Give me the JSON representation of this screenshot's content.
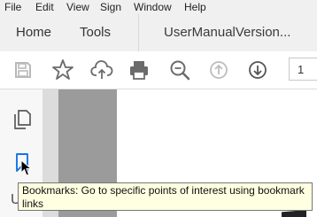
{
  "menu": [
    "File",
    "Edit",
    "View",
    "Sign",
    "Window",
    "Help"
  ],
  "tabs": {
    "home": "Home",
    "tools": "Tools",
    "document": "UserManualVersion..."
  },
  "toolbar": {
    "page_number": "1"
  },
  "sidebar": {
    "partial_letter": "U"
  },
  "tooltip": {
    "text": "Bookmarks: Go to specific points of interest using bookmark links"
  },
  "colors": {
    "toolbar_icon": "#6b6b6b",
    "bookmark_icon": "#1473e6",
    "tooltip_bg": "#ffffe1"
  },
  "icons": [
    "save-icon",
    "star-icon",
    "cloud-upload-icon",
    "print-icon",
    "zoom-out-icon",
    "previous-page-icon",
    "next-page-icon",
    "page-thumbnails-icon",
    "bookmark-icon"
  ]
}
